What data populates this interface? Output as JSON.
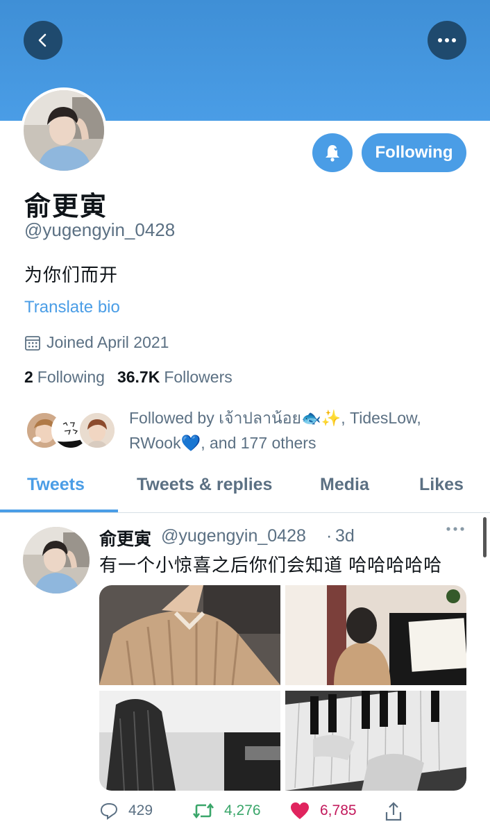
{
  "profile": {
    "name": "俞更寅",
    "handle": "@yugengyin_0428",
    "bio": "为你们而开",
    "translate_label": "Translate bio",
    "joined": "Joined April 2021",
    "following_count": "2",
    "following_label": "Following",
    "followers_count": "36.7K",
    "followers_label": "Followers",
    "followed_by": "Followed by เจ้าปลาน้อย🐟✨, TidesLow, RWook💙, and 177 others"
  },
  "buttons": {
    "follow_state": "Following"
  },
  "tabs": [
    {
      "label": "Tweets",
      "active": true
    },
    {
      "label": "Tweets & replies",
      "active": false
    },
    {
      "label": "Media",
      "active": false
    },
    {
      "label": "Likes",
      "active": false
    }
  ],
  "tweet": {
    "name": "俞更寅",
    "handle": "@yugengyin_0428",
    "dot": "·",
    "time": "3d",
    "text": "有一个小惊喜之后你们会知道 哈哈哈哈哈",
    "replies": "429",
    "retweets": "4,276",
    "likes": "6,785"
  },
  "icons": {
    "back": "back-arrow-icon",
    "more": "more-dots-icon",
    "bell": "notification-bell-icon",
    "calendar": "calendar-icon",
    "reply": "reply-icon",
    "retweet": "retweet-icon",
    "like": "heart-icon",
    "share": "share-icon"
  },
  "colors": {
    "accent": "#4a9de6",
    "banner": "#4a9de6",
    "secondary_text": "#5b7083",
    "retweet": "#3aa66a",
    "like": "#c2185b"
  }
}
